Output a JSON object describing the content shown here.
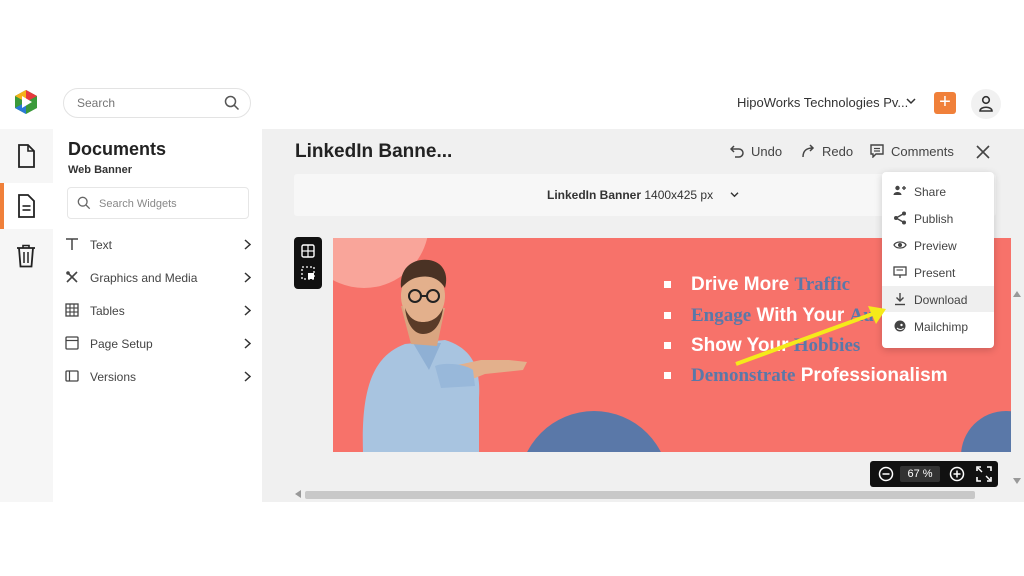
{
  "header": {
    "search_placeholder": "Search",
    "company": "HipoWorks Technologies Pv...",
    "add_label": "+"
  },
  "panel": {
    "title": "Documents",
    "subtitle": "Web Banner",
    "search_placeholder": "Search Widgets",
    "items": [
      {
        "label": "Text",
        "icon": "text-icon"
      },
      {
        "label": "Graphics and Media",
        "icon": "graphics-icon"
      },
      {
        "label": "Tables",
        "icon": "table-icon"
      },
      {
        "label": "Page Setup",
        "icon": "page-setup-icon"
      },
      {
        "label": "Versions",
        "icon": "versions-icon"
      }
    ]
  },
  "editor": {
    "doc_title": "LinkedIn Banne...",
    "undo": "Undo",
    "redo": "Redo",
    "comments": "Comments",
    "size_name": "LinkedIn Banner",
    "size_dims": "1400x425 px"
  },
  "banner": {
    "line1_a": "Drive More ",
    "line1_b": "Traffic",
    "line2_a": "Engage",
    "line2_b": " With Your ",
    "line2_c": "Au",
    "line3_a": "Show Your ",
    "line3_b": "Hobbies",
    "line4_a": "Demonstrate",
    "line4_b": " Professionalism"
  },
  "dropdown": {
    "items": [
      "Share",
      "Publish",
      "Preview",
      "Present",
      "Download",
      "Mailchimp"
    ],
    "active": "Download"
  },
  "zoom": {
    "value": "67 %"
  },
  "colors": {
    "accent": "#f0803a",
    "banner": "#f7726a",
    "banner_blue": "#5a78a8",
    "arrow": "#f5ea1a"
  }
}
